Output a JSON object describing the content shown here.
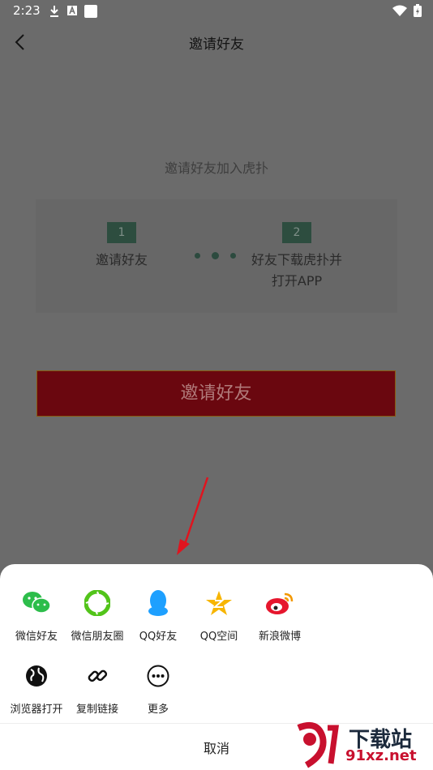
{
  "status_bar": {
    "time": "2:23",
    "icons": [
      "download-icon",
      "a-icon",
      "square-icon"
    ],
    "right_icons": [
      "wifi-icon",
      "battery-icon"
    ]
  },
  "app_bar": {
    "title": "邀请好友",
    "back_icon": "back-arrow-icon"
  },
  "main": {
    "subtitle": "邀请好友加入虎扑",
    "steps": [
      {
        "number": "1",
        "label": "邀请好友"
      },
      {
        "number": "2",
        "label_line1": "好友下载虎扑并",
        "label_line2": "打开APP"
      }
    ],
    "invite_button": "邀请好友"
  },
  "share_sheet": {
    "row1": [
      {
        "label": "微信好友",
        "icon": "wechat-icon",
        "color": "#2dbd4b"
      },
      {
        "label": "微信朋友圈",
        "icon": "moments-icon",
        "color": "#52c41a"
      },
      {
        "label": "QQ好友",
        "icon": "qq-icon",
        "color": "#1ea0ff"
      },
      {
        "label": "QQ空间",
        "icon": "qzone-icon",
        "color": "#f7b500"
      },
      {
        "label": "新浪微博",
        "icon": "weibo-icon",
        "color": "#e6162d"
      }
    ],
    "row2": [
      {
        "label": "浏览器打开",
        "icon": "globe-icon"
      },
      {
        "label": "复制链接",
        "icon": "link-icon"
      },
      {
        "label": "更多",
        "icon": "more-icon"
      }
    ],
    "cancel": "取消"
  },
  "watermark": {
    "text": "下载站",
    "url": "91xz.net"
  },
  "colors": {
    "overlay": "#6b6b6b",
    "invite_bg": "#6a070f",
    "step_badge": "#2d4d3f"
  }
}
